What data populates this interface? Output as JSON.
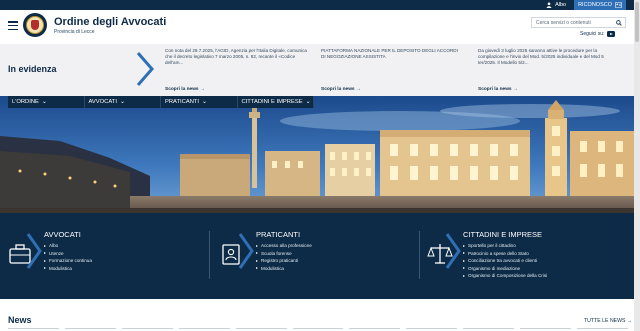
{
  "topbar": {
    "albo_label": "Albo",
    "riconosco_label": "RICONOSCO"
  },
  "header": {
    "title": "Ordine degli Avvocati",
    "subtitle": "Provincia di Lecce",
    "search_placeholder": "Cerca servizi o contenuti",
    "social_label": "Seguici su:"
  },
  "evidenza": {
    "title": "In evidenza",
    "items": [
      {
        "text": "Con nota del 29.7.2025, l'AGID, Agenzia per l'Italia Digitale, comunica che il decreto legislativo 7 marzo 2005, n. 82, recante il «Codice dell'am...",
        "link": "Scopri la news"
      },
      {
        "text": "PIATTAFORMA NAZIONALE PER IL DEPOSITO DEGLI ACCORDI DI NEGOZIAZIONE ASSISTITA",
        "link": "Scopri la news"
      },
      {
        "text": "Da giovedì 3 luglio 2025 saranno attive le procedure per la compilazione e l'invio del Mod. 5/2025 individuale e del Mod 5 ter/2025. Il Modello 5/2...",
        "link": "Scopri la news"
      }
    ]
  },
  "menu": {
    "items": [
      "L'ORDINE",
      "AVVOCATI",
      "PRATICANTI",
      "CITTADINI E IMPRESE"
    ]
  },
  "cards": [
    {
      "title": "AVVOCATI",
      "icon": "briefcase-icon",
      "links": [
        "Albo",
        "Utenze",
        "Formazione continua",
        "Modulistica"
      ]
    },
    {
      "title": "PRATICANTI",
      "icon": "document-user-icon",
      "links": [
        "Accesso alla professione",
        "Scuola forense",
        "Registro praticanti",
        "Modulistica"
      ]
    },
    {
      "title": "CITTADINI E IMPRESE",
      "icon": "justice-scale-icon",
      "links": [
        "Sportello per il cittadino",
        "Patrocinio a spese dello Stato",
        "Conciliazione tra avvocati e clienti",
        "Organismo di mediazione",
        "Organismo di Composizione della Crisi"
      ]
    }
  ],
  "news": {
    "title": "News",
    "all_label": "TUTTE LE NEWS"
  },
  "colors": {
    "navy": "#0d2b47",
    "accent_blue": "#2f6fb6",
    "light_bg": "#f1f1f3"
  }
}
